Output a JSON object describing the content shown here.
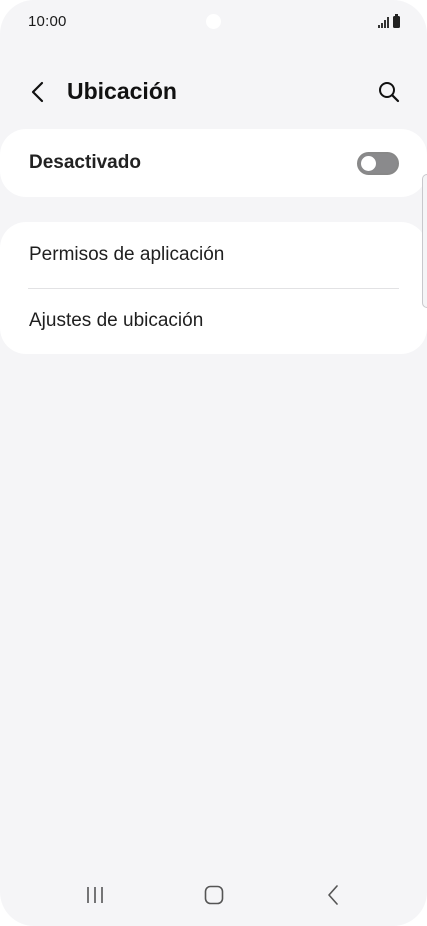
{
  "status_bar": {
    "time": "10:00"
  },
  "header": {
    "title": "Ubicación",
    "back_icon": "chevron-left-icon",
    "search_icon": "search-icon"
  },
  "location_toggle": {
    "label": "Desactivado",
    "state": "off"
  },
  "menu": {
    "items": [
      {
        "label": "Permisos de aplicación"
      },
      {
        "label": "Ajustes de ubicación"
      }
    ]
  },
  "navigation_bar": {
    "recents_icon": "recents-icon",
    "home_icon": "home-icon",
    "back_icon": "back-icon"
  },
  "colors": {
    "background": "#f5f5f7",
    "card": "#ffffff",
    "toggle_off": "#8a8a8c",
    "text_primary": "#111111"
  }
}
